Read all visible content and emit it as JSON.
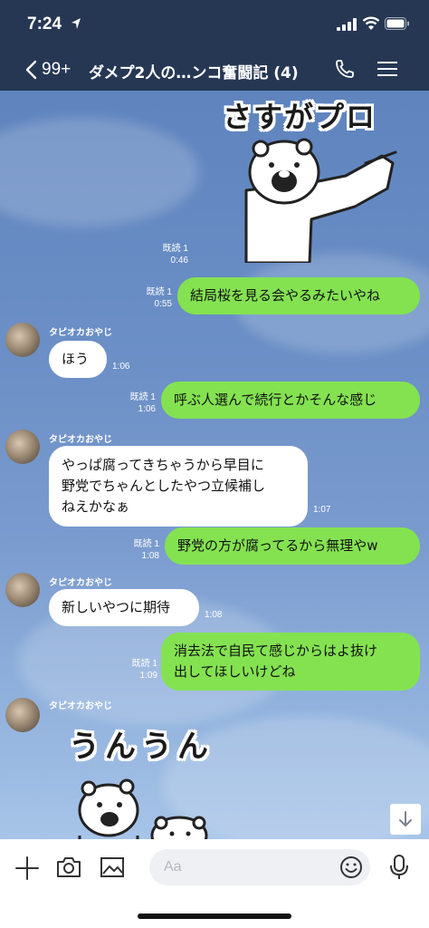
{
  "status_bar": {
    "time": "7:24"
  },
  "header": {
    "unread_count": "99+",
    "room_title": "ダメプ2人の…ンコ奮闘記 (4)",
    "icons": [
      "back-chevron-icon",
      "phone-icon",
      "menu-icon"
    ]
  },
  "stickers": {
    "top_text": "さすがプロ",
    "bottom_text": "うんうん"
  },
  "messages": [
    {
      "side": "me",
      "type": "sticker",
      "read": "既読 1",
      "time": "0:46"
    },
    {
      "side": "me",
      "text": "結局桜を見る会やるみたいやね",
      "read": "既読 1",
      "time": "0:55"
    },
    {
      "side": "them",
      "sender": "タピオカおやじ",
      "text": "ほう",
      "time": "1:06"
    },
    {
      "side": "me",
      "text": "呼ぶ人選んで続行とかそんな感じ",
      "read": "既読 1",
      "time": "1:06"
    },
    {
      "side": "them",
      "sender": "タピオカおやじ",
      "lines": [
        "やっぱ腐ってきちゃうから早目に",
        "野党でちゃんとしたやつ立候補し",
        "ねえかなぁ"
      ],
      "time": "1:07"
    },
    {
      "side": "me",
      "text": "野党の方が腐ってるから無理やw",
      "read": "既読 1",
      "time": "1:08"
    },
    {
      "side": "them",
      "sender": "タピオカおやじ",
      "text": "新しいやつに期待",
      "time": "1:08"
    },
    {
      "side": "me",
      "lines": [
        "消去法で自民て感じからはよ抜け",
        "出してほしいけどね"
      ],
      "read": "既読 1",
      "time": "1:09"
    },
    {
      "side": "them",
      "sender": "タピオカおやじ",
      "type": "sticker"
    }
  ],
  "input": {
    "placeholder": "Aa"
  },
  "colors": {
    "header_bg": "#263754",
    "my_bubble": "#84e251",
    "their_bubble": "#ffffff",
    "chat_bg": "#6b8fc6"
  }
}
